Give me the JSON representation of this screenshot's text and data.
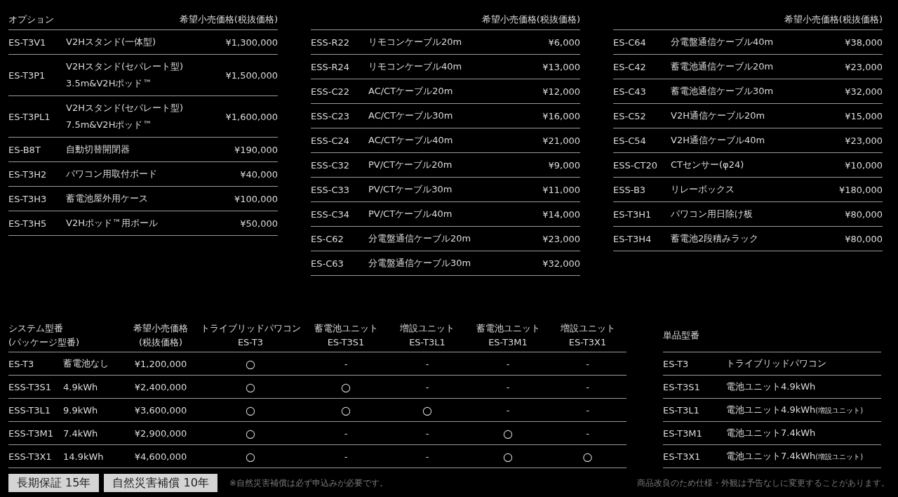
{
  "option_tables": [
    {
      "header": {
        "column_1": "オプション",
        "price": "希望小売価格(税抜価格)"
      },
      "rows": [
        {
          "code": "ES-T3V1",
          "name": [
            "V2Hスタンド(一体型)"
          ],
          "price": "¥1,300,000"
        },
        {
          "code": "ES-T3P1",
          "name": [
            "V2Hスタンド(セパレート型)",
            "3.5m&V2Hポッド™"
          ],
          "price": "¥1,500,000"
        },
        {
          "code": "ES-T3PL1",
          "name": [
            "V2Hスタンド(セパレート型)",
            "7.5m&V2Hポッド™"
          ],
          "price": "¥1,600,000"
        },
        {
          "code": "ES-B8T",
          "name": [
            "自動切替開閉器"
          ],
          "price": "¥190,000"
        },
        {
          "code": "ES-T3H2",
          "name": [
            "パワコン用取付ボード"
          ],
          "price": "¥40,000"
        },
        {
          "code": "ES-T3H3",
          "name": [
            "蓄電池屋外用ケース"
          ],
          "price": "¥100,000"
        },
        {
          "code": "ES-T3H5",
          "name": [
            "V2Hポッド™用ポール"
          ],
          "price": "¥50,000"
        }
      ]
    },
    {
      "header": {
        "price": "希望小売価格(税抜価格)"
      },
      "rows": [
        {
          "code": "ESS-R22",
          "name": [
            "リモコンケーブル20m"
          ],
          "price": "¥6,000"
        },
        {
          "code": "ESS-R24",
          "name": [
            "リモコンケーブル40m"
          ],
          "price": "¥13,000"
        },
        {
          "code": "ESS-C22",
          "name": [
            "AC/CTケーブル20m"
          ],
          "price": "¥12,000"
        },
        {
          "code": "ESS-C23",
          "name": [
            "AC/CTケーブル30m"
          ],
          "price": "¥16,000"
        },
        {
          "code": "ESS-C24",
          "name": [
            "AC/CTケーブル40m"
          ],
          "price": "¥21,000"
        },
        {
          "code": "ESS-C32",
          "name": [
            "PV/CTケーブル20m"
          ],
          "price": "¥9,000"
        },
        {
          "code": "ESS-C33",
          "name": [
            "PV/CTケーブル30m"
          ],
          "price": "¥11,000"
        },
        {
          "code": "ESS-C34",
          "name": [
            "PV/CTケーブル40m"
          ],
          "price": "¥14,000"
        },
        {
          "code": "ES-C62",
          "name": [
            "分電盤通信ケーブル20m"
          ],
          "price": "¥23,000"
        },
        {
          "code": "ES-C63",
          "name": [
            "分電盤通信ケーブル30m"
          ],
          "price": "¥32,000"
        }
      ]
    },
    {
      "header": {
        "price": "希望小売価格(税抜価格)"
      },
      "rows": [
        {
          "code": "ES-C64",
          "name": [
            "分電盤通信ケーブル40m"
          ],
          "price": "¥38,000"
        },
        {
          "code": "ES-C42",
          "name": [
            "蓄電池通信ケーブル20m"
          ],
          "price": "¥23,000"
        },
        {
          "code": "ES-C43",
          "name": [
            "蓄電池通信ケーブル30m"
          ],
          "price": "¥32,000"
        },
        {
          "code": "ES-C52",
          "name": [
            "V2H通信ケーブル20m"
          ],
          "price": "¥15,000"
        },
        {
          "code": "ES-C54",
          "name": [
            "V2H通信ケーブル40m"
          ],
          "price": "¥23,000"
        },
        {
          "code": "ESS-CT20",
          "name": [
            "CTセンサー(φ24)"
          ],
          "price": "¥10,000"
        },
        {
          "code": "ESS-B3",
          "name": [
            "リレーボックス"
          ],
          "price": "¥180,000"
        },
        {
          "code": "ES-T3H1",
          "name": [
            "パワコン用日除け板"
          ],
          "price": "¥80,000"
        },
        {
          "code": "ES-T3H4",
          "name": [
            "蓄電池2段積みラック"
          ],
          "price": "¥80,000"
        }
      ]
    }
  ],
  "system_table": {
    "columns": [
      {
        "lines": [
          "システム型番",
          "(パッケージ型番)"
        ]
      },
      {
        "lines": [
          "希望小売価格",
          "(税抜価格)"
        ]
      },
      {
        "lines": [
          "トライブリッドパワコン",
          "ES-T3"
        ]
      },
      {
        "lines": [
          "蓄電池ユニット",
          "ES-T3S1"
        ]
      },
      {
        "lines": [
          "増設ユニット",
          "ES-T3L1"
        ]
      },
      {
        "lines": [
          "蓄電池ユニット",
          "ES-T3M1"
        ]
      },
      {
        "lines": [
          "増設ユニット",
          "ES-T3X1"
        ]
      }
    ],
    "rows": [
      {
        "model": "ES-T3",
        "capacity": "蓄電池なし",
        "price": "¥1,200,000",
        "marks": [
          "○",
          "-",
          "-",
          "-",
          "-"
        ]
      },
      {
        "model": "ESS-T3S1",
        "capacity": "4.9kWh",
        "price": "¥2,400,000",
        "marks": [
          "○",
          "○",
          "-",
          "-",
          "-"
        ]
      },
      {
        "model": "ESS-T3L1",
        "capacity": "9.9kWh",
        "price": "¥3,600,000",
        "marks": [
          "○",
          "○",
          "○",
          "-",
          "-"
        ]
      },
      {
        "model": "ESS-T3M1",
        "capacity": "7.4kWh",
        "price": "¥2,900,000",
        "marks": [
          "○",
          "-",
          "-",
          "○",
          "-"
        ]
      },
      {
        "model": "ESS-T3X1",
        "capacity": "14.9kWh",
        "price": "¥4,600,000",
        "marks": [
          "○",
          "-",
          "-",
          "○",
          "○"
        ]
      }
    ]
  },
  "single_table": {
    "header": "単品型番",
    "rows": [
      {
        "model": "ES-T3",
        "name": "トライブリッドパワコン"
      },
      {
        "model": "ES-T3S1",
        "name": "電池ユニット4.9kWh"
      },
      {
        "model": "ES-T3L1",
        "name": "電池ユニット4.9kWh",
        "note": "(増設ユニット)"
      },
      {
        "model": "ES-T3M1",
        "name": "電池ユニット7.4kWh"
      },
      {
        "model": "ES-T3X1",
        "name": "電池ユニット7.4kWh",
        "note": "(増設ユニット)"
      }
    ]
  },
  "footer": {
    "badges": [
      "長期保証 15年",
      "自然災害補償 10年"
    ],
    "note": "※自然災害補償は必ず申込みが必要です。",
    "disclaimer": "商品改良のため仕様・外観は予告なしに変更することがあります。"
  }
}
